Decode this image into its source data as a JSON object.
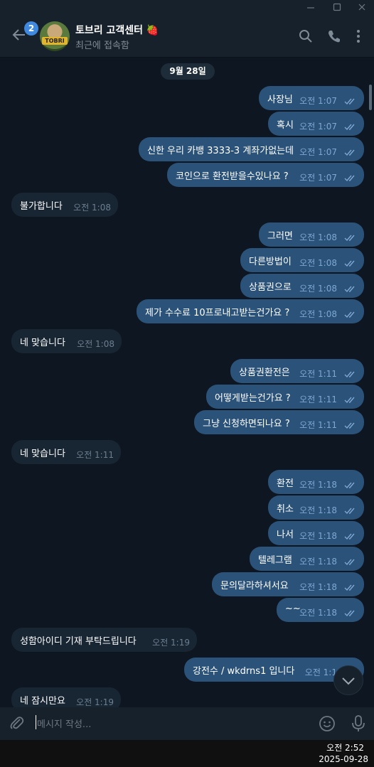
{
  "header": {
    "unread_count": "2",
    "avatar_text": "TOBRI",
    "title": "토브리 고객센터 🍓",
    "status": "최근에 접속함"
  },
  "chat": {
    "date": "9월 28일",
    "messages": [
      {
        "dir": "out",
        "text": "사장님",
        "time": "오전 1:07"
      },
      {
        "dir": "out",
        "text": "혹시",
        "time": "오전 1:07"
      },
      {
        "dir": "out",
        "text": "신한 우리 카뱅 3333-3 계좌가없는데",
        "time": "오전 1:07"
      },
      {
        "dir": "out",
        "text": "코인으로 환전받을수있나요 ?",
        "time": "오전 1:07"
      },
      {
        "dir": "in",
        "text": "불가합니다",
        "time": "오전 1:08"
      },
      {
        "dir": "out",
        "text": "그러면",
        "time": "오전 1:08"
      },
      {
        "dir": "out",
        "text": "다른방법이",
        "time": "오전 1:08"
      },
      {
        "dir": "out",
        "text": "상품권으로",
        "time": "오전 1:08"
      },
      {
        "dir": "out",
        "text": "제가 수수료 10프로내고받는건가요 ?",
        "time": "오전 1:08"
      },
      {
        "dir": "in",
        "text": "네 맞습니다",
        "time": "오전 1:08"
      },
      {
        "dir": "out",
        "text": "상품권환전은",
        "time": "오전 1:11"
      },
      {
        "dir": "out",
        "text": "어떻게받는건가요 ?",
        "time": "오전 1:11"
      },
      {
        "dir": "out",
        "text": "그냥 신청하면되나요 ?",
        "time": "오전 1:11"
      },
      {
        "dir": "in",
        "text": "네 맞습니다",
        "time": "오전 1:11"
      },
      {
        "dir": "out",
        "text": "환전",
        "time": "오전 1:18"
      },
      {
        "dir": "out",
        "text": "취소",
        "time": "오전 1:18"
      },
      {
        "dir": "out",
        "text": "나서",
        "time": "오전 1:18"
      },
      {
        "dir": "out",
        "text": "텔레그램",
        "time": "오전 1:18"
      },
      {
        "dir": "out",
        "text": "문의달라하셔서요",
        "time": "오전 1:18"
      },
      {
        "dir": "out",
        "text": "~~",
        "time": "오전 1:18"
      },
      {
        "dir": "in",
        "text": "성함아이디 기재 부탁드립니다",
        "time": "오전 1:19"
      },
      {
        "dir": "out",
        "text": "강전수 / wkdrns1 입니다",
        "time": "오전 1:1"
      },
      {
        "dir": "in",
        "text": "네 잠시만요",
        "time": "오전 1:19"
      }
    ]
  },
  "composer": {
    "placeholder": "메시지 작성..."
  },
  "taskbar": {
    "time": "오전 2:52",
    "date": "2025-09-28"
  },
  "colors": {
    "background": "#0e1621",
    "outgoing": "#2b5278",
    "incoming": "#182533",
    "accent": "#3f8ae0"
  },
  "icons": [
    "back-arrow-icon",
    "search-icon",
    "phone-icon",
    "more-vertical-icon",
    "attach-icon",
    "emoji-icon",
    "microphone-icon",
    "chevron-down-icon",
    "double-check-icon"
  ]
}
